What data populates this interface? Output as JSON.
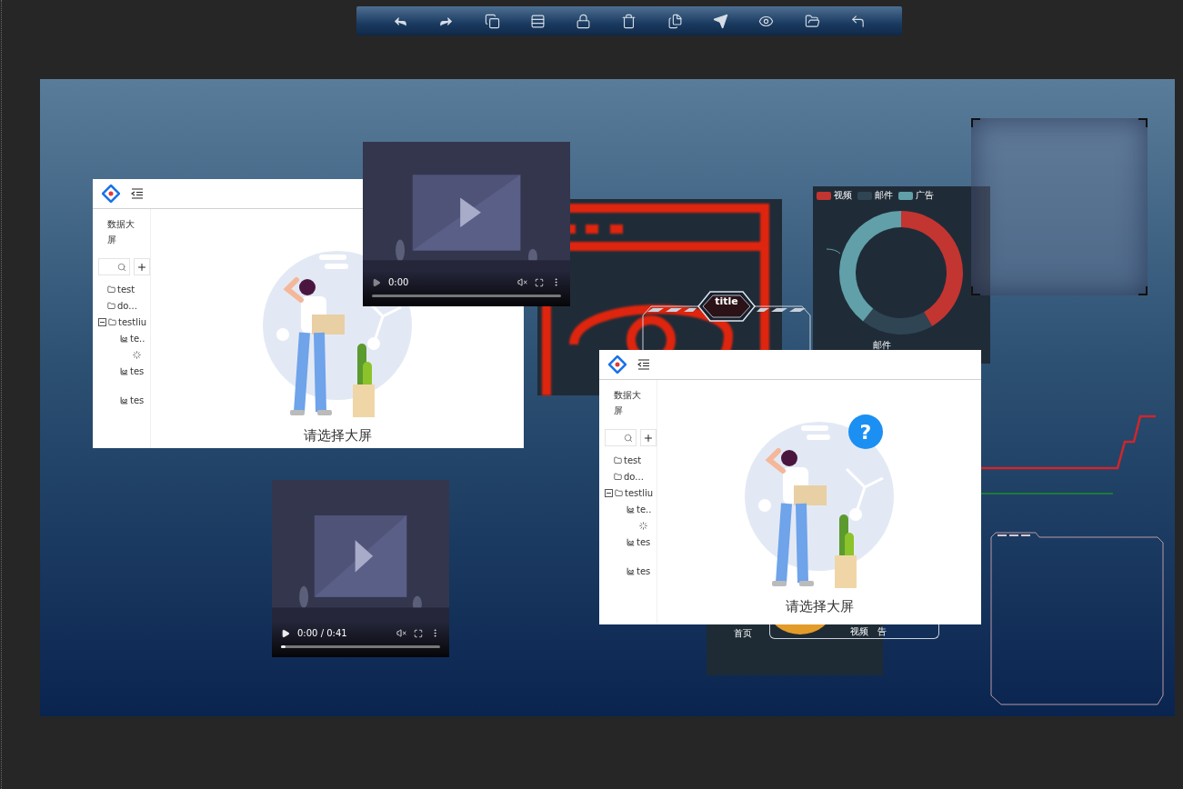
{
  "windows": [
    {
      "sidebar_title": "数据大屏",
      "search": {
        "kind": "search"
      },
      "tree": [
        {
          "label": "test",
          "kind": "folder"
        },
        {
          "label": "do...",
          "kind": "folder"
        },
        {
          "label": "testliu",
          "kind": "folder",
          "expanded": true,
          "children": [
            {
              "label": "te..",
              "kind": "chart"
            },
            {
              "kind": "loading"
            },
            {
              "label": "tes",
              "kind": "chart"
            },
            {
              "label": "tes",
              "kind": "chart"
            }
          ]
        }
      ],
      "empty_text": "请选择大屏"
    },
    {
      "sidebar_title": "数据大屏",
      "search": {
        "kind": "search"
      },
      "tree": [
        {
          "label": "test",
          "kind": "folder"
        },
        {
          "label": "do...",
          "kind": "folder"
        },
        {
          "label": "testliu",
          "kind": "folder",
          "expanded": true,
          "children": [
            {
              "label": "te..",
              "kind": "chart"
            },
            {
              "kind": "loading"
            },
            {
              "label": "tes",
              "kind": "chart"
            },
            {
              "label": "tes",
              "kind": "chart"
            }
          ]
        }
      ],
      "empty_text": "请选择大屏",
      "help_badge": "?"
    }
  ],
  "videos": [
    {
      "time": "0:00",
      "level": 0
    },
    {
      "time": "0:00 / 0:41",
      "level": 0.03
    }
  ],
  "title_frame": {
    "title": "title"
  },
  "donut": {
    "legend": [
      {
        "label": "视频",
        "color": "#c23531"
      },
      {
        "label": "邮件",
        "color": "#2f4554"
      },
      {
        "label": "广告",
        "color": "#61a0a8"
      }
    ],
    "label": "邮件"
  },
  "pie_panel": {
    "labels": [
      "首页",
      "视频",
      "告"
    ]
  }
}
